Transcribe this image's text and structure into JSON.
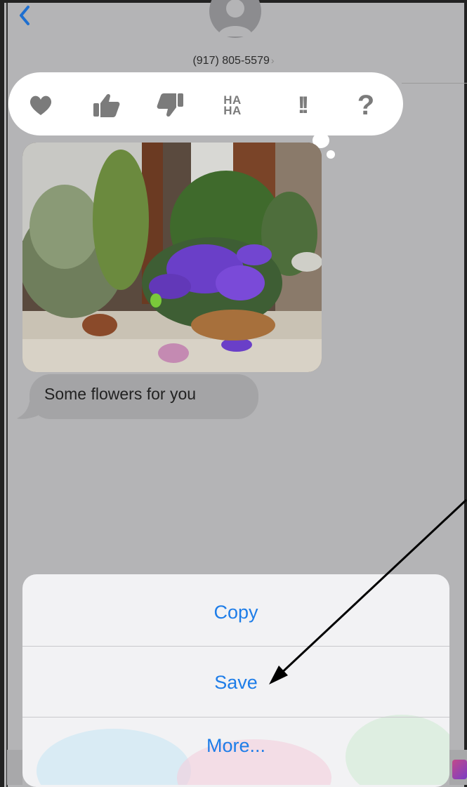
{
  "header": {
    "back_icon": "chevron-left-icon",
    "contact_avatar": "person-silhouette-icon",
    "contact_phone": "(917) 805-5579",
    "contact_chevron": "›"
  },
  "tapbacks": [
    {
      "name": "heart",
      "icon": "heart-icon"
    },
    {
      "name": "thumbs-up",
      "icon": "thumbs-up-icon"
    },
    {
      "name": "thumbs-down",
      "icon": "thumbs-down-icon"
    },
    {
      "name": "haha",
      "label_line1": "HA",
      "label_line2": "HA"
    },
    {
      "name": "emphasize",
      "label": "!!"
    },
    {
      "name": "question",
      "label": "?"
    }
  ],
  "message": {
    "image": "flowers-photo",
    "text": "Some flowers for you"
  },
  "action_sheet": {
    "copy": "Copy",
    "save": "Save",
    "more": "More..."
  },
  "colors": {
    "accent_blue": "#1E7DE8",
    "dim_background": "#B4B4B6",
    "bubble_gray": "#A4A4A6"
  }
}
